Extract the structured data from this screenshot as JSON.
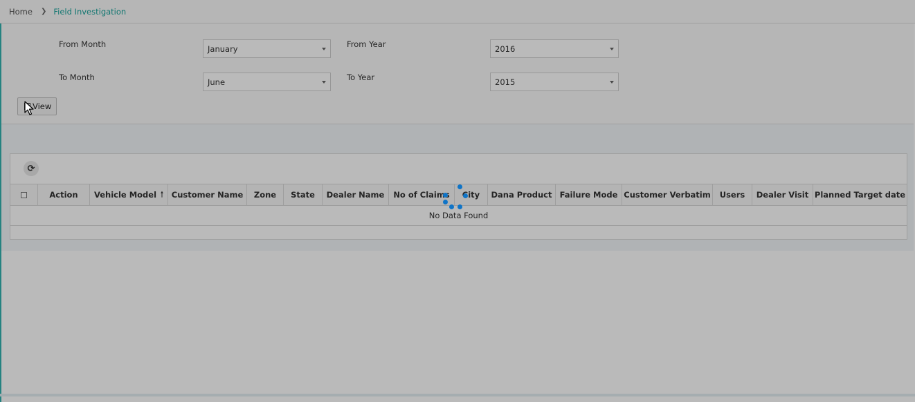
{
  "breadcrumb": {
    "home": "Home",
    "separator_icon": "chevron-right-icon",
    "current": "Field Investigation"
  },
  "filters": {
    "from_month": {
      "label": "From Month",
      "value": "January"
    },
    "from_year": {
      "label": "From Year",
      "value": "2016"
    },
    "to_month": {
      "label": "To Month",
      "value": "June"
    },
    "to_year": {
      "label": "To Year",
      "value": "2015"
    },
    "view_button": {
      "label": "View",
      "icon": "view-icon"
    }
  },
  "grid": {
    "refresh_icon": "refresh-icon",
    "columns": [
      {
        "key": "select",
        "label": ""
      },
      {
        "key": "action",
        "label": "Action"
      },
      {
        "key": "vehicle_model",
        "label": "Vehicle Model",
        "sort": "ascending"
      },
      {
        "key": "customer_name",
        "label": "Customer Name"
      },
      {
        "key": "zone",
        "label": "Zone"
      },
      {
        "key": "state",
        "label": "State"
      },
      {
        "key": "dealer_name",
        "label": "Dealer Name"
      },
      {
        "key": "no_of_claims",
        "label": "No of Claims"
      },
      {
        "key": "city",
        "label": "City"
      },
      {
        "key": "dana_product",
        "label": "Dana Product"
      },
      {
        "key": "failure_mode",
        "label": "Failure Mode"
      },
      {
        "key": "customer_verbatim",
        "label": "Customer Verbatim"
      },
      {
        "key": "users",
        "label": "Users"
      },
      {
        "key": "dealer_visit",
        "label": "Dealer Visit"
      },
      {
        "key": "planned_target_date",
        "label": "Planned Target date"
      }
    ],
    "empty_message": "No Data Found"
  },
  "state": {
    "loading": true
  },
  "colors": {
    "accent": "#1aa39b",
    "left_accent": "#34b3b0",
    "spinner": "#0f74c7",
    "overlay": "rgba(0,0,0,0.27)"
  }
}
